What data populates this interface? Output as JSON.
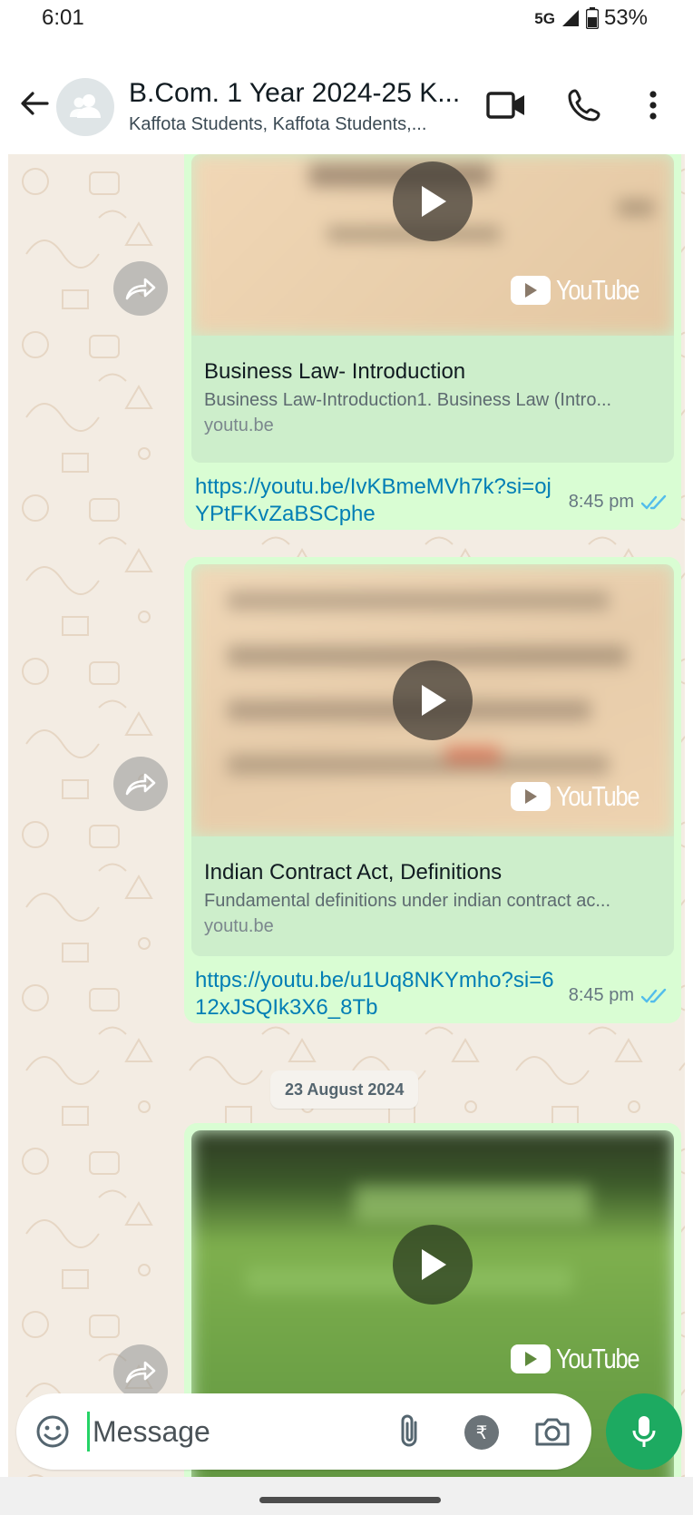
{
  "status_bar": {
    "time": "6:01",
    "network": "5G",
    "battery": "53%",
    "icons": [
      "signal-icon",
      "battery-icon"
    ]
  },
  "header": {
    "title": "B.Com. 1 Year 2024-25 K...",
    "subtitle": "Kaffota Students, Kaffota Students,...",
    "icons": [
      "back-arrow-icon",
      "group-avatar-icon",
      "video-call-icon",
      "voice-call-icon",
      "more-options-icon"
    ]
  },
  "messages": [
    {
      "type": "link_preview",
      "preview_title": "Business Law- Introduction",
      "preview_description": "Business Law-Introduction1. Business Law (Intro...",
      "preview_domain": "youtu.be",
      "thumbnail_badge": "YouTube",
      "link": "https://youtu.be/IvKBmeMVh7k?si=ojYPtFKvZaBSCphe",
      "time": "8:45 pm",
      "status": "read"
    },
    {
      "type": "link_preview",
      "preview_title": "Indian Contract Act, Definitions",
      "preview_description": "Fundamental definitions under indian contract ac...",
      "preview_domain": "youtu.be",
      "thumbnail_badge": "YouTube",
      "link": "https://youtu.be/u1Uq8NKYmho?si=612xJSQIk3X6_8Tb",
      "time": "8:45 pm",
      "status": "read"
    },
    {
      "type": "link_preview_partial",
      "thumbnail_badge": "YouTube"
    }
  ],
  "date_divider": "23 August 2024",
  "composer": {
    "placeholder": "Message",
    "rupee_symbol": "₹",
    "icons": [
      "emoji-icon",
      "attach-icon",
      "payment-icon",
      "camera-icon",
      "mic-icon"
    ]
  },
  "colors": {
    "bubble": "#d9fdd3",
    "preview_card": "#cdeecb",
    "link": "#027eb5",
    "read_ticks": "#53bdeb",
    "mic_button": "#1daa61",
    "chat_background": "#f3ece3"
  }
}
